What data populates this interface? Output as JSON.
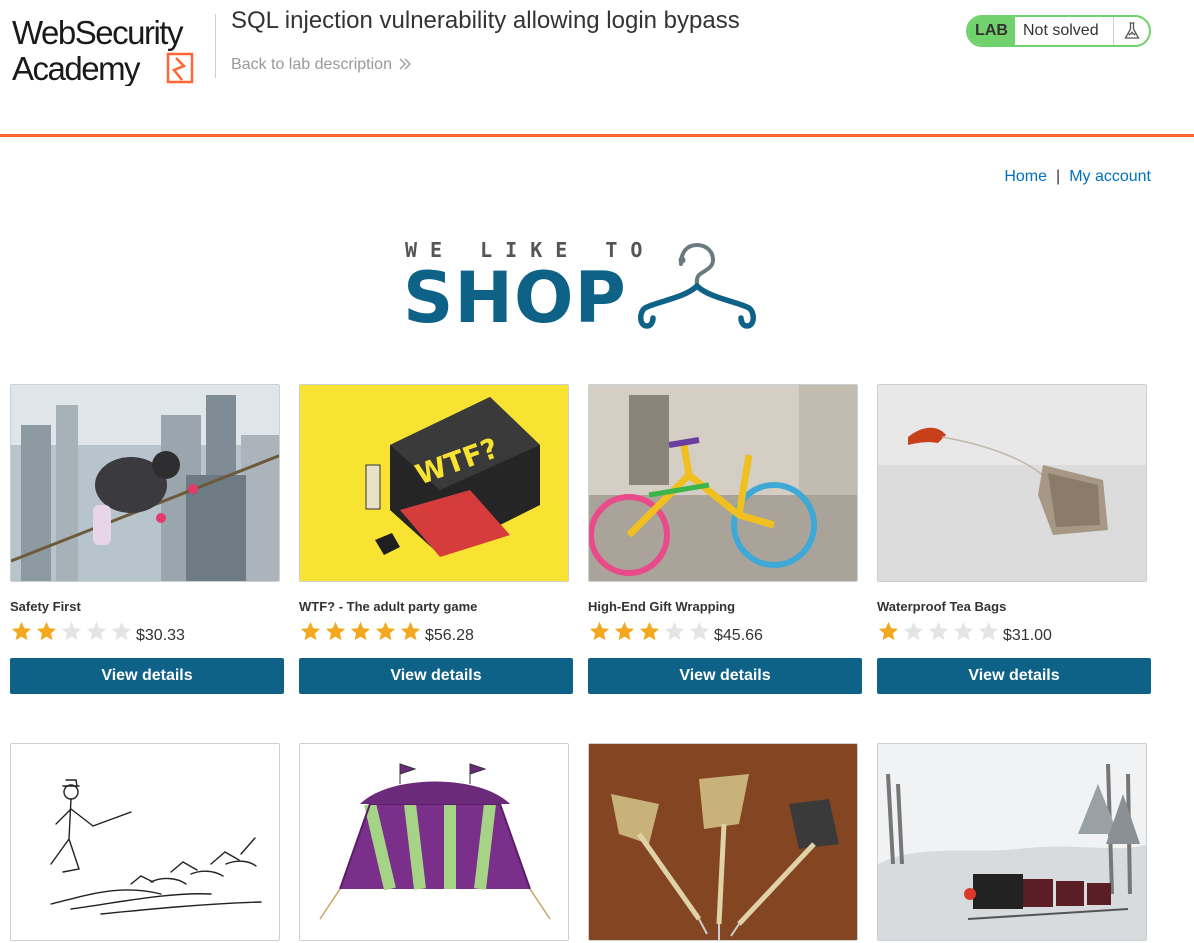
{
  "header": {
    "logo_text": "WebSecurity Academy",
    "lab_title": "SQL injection vulnerability allowing login bypass",
    "back_link": "Back to lab description",
    "lab_badge": "LAB",
    "lab_status": "Not solved",
    "accent_color": "#ff6633",
    "status_color": "#70d16d"
  },
  "nav": {
    "home": "Home",
    "separator": "|",
    "account": "My account"
  },
  "banner": {
    "line1": "WE LIKE TO",
    "line2": "SHOP",
    "icon": "hanger-icon"
  },
  "products": [
    {
      "name": "Safety First",
      "rating": 2,
      "price": "$30.33",
      "button": "View details",
      "image": "climber-photo"
    },
    {
      "name": "WTF? - The adult party game",
      "rating": 5,
      "price": "$56.28",
      "button": "View details",
      "image": "party-game-box-photo"
    },
    {
      "name": "High-End Gift Wrapping",
      "rating": 3,
      "price": "$45.66",
      "button": "View details",
      "image": "knitted-bicycle-photo"
    },
    {
      "name": "Waterproof Tea Bags",
      "rating": 1,
      "price": "$31.00",
      "button": "View details",
      "image": "tea-bag-photo"
    },
    {
      "image": "pied-piper-drawing"
    },
    {
      "image": "circus-tent-photo"
    },
    {
      "image": "darts-photo"
    },
    {
      "image": "steam-train-photo"
    }
  ],
  "max_rating": 5,
  "colors": {
    "button": "#0e6288",
    "link": "#0071bc",
    "star_on": "#f4a81d",
    "star_off": "#e4e4e4"
  }
}
